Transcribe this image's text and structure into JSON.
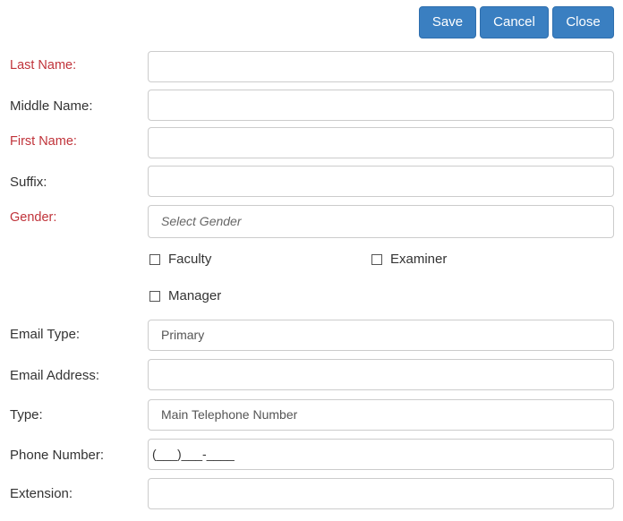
{
  "toolbar": {
    "save_label": "Save",
    "cancel_label": "Cancel",
    "close_label": "Close",
    "button_color": "#3a7fc1"
  },
  "form": {
    "last_name": {
      "label": "Last Name:",
      "value": "",
      "required": true
    },
    "middle_name": {
      "label": "Middle Name:",
      "value": ""
    },
    "first_name": {
      "label": "First Name:",
      "value": "",
      "required": true
    },
    "suffix": {
      "label": "Suffix:",
      "value": ""
    },
    "gender": {
      "label": "Gender:",
      "placeholder": "Select Gender",
      "required": true
    },
    "roles": {
      "faculty": {
        "label": "Faculty",
        "checked": false
      },
      "examiner": {
        "label": "Examiner",
        "checked": false
      },
      "manager": {
        "label": "Manager",
        "checked": false
      }
    },
    "email_type": {
      "label": "Email Type:",
      "value": "Primary"
    },
    "email_address": {
      "label": "Email Address:",
      "value": ""
    },
    "phone_type": {
      "label": "Type:",
      "value": "Main Telephone Number"
    },
    "phone_number": {
      "label": "Phone Number:",
      "value": "(___)___-____"
    },
    "extension": {
      "label": "Extension:",
      "value": ""
    }
  },
  "colors": {
    "required_label": "#c0333a",
    "label": "#333333",
    "field_border": "#cccccc"
  }
}
